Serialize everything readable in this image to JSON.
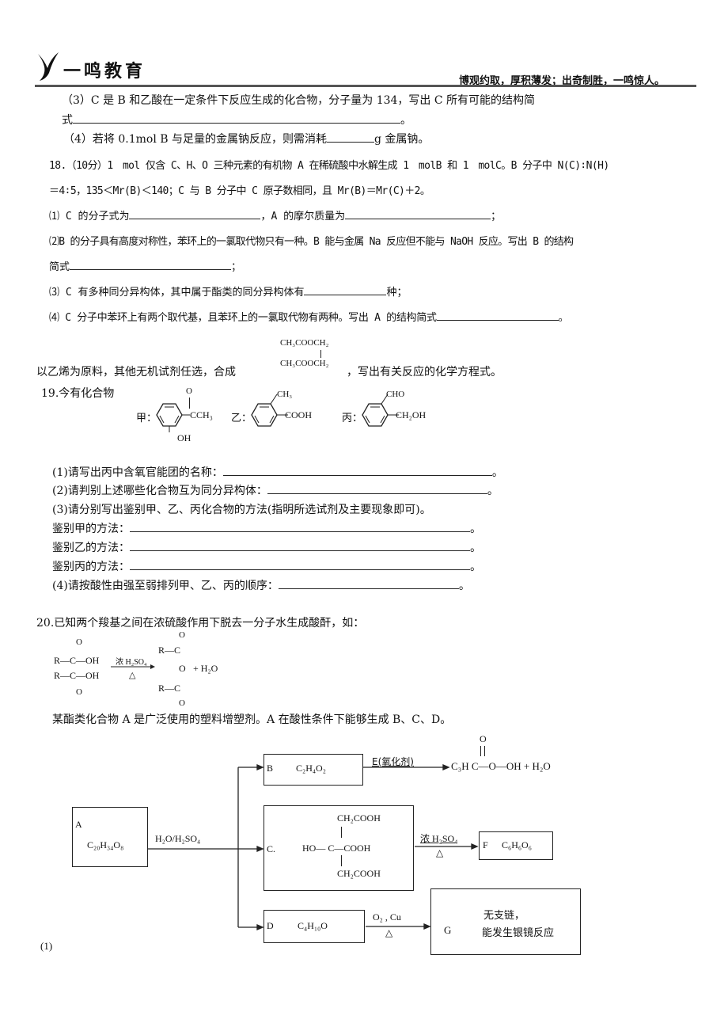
{
  "header": {
    "logo_text": "一鸣教育",
    "slogan": "博观约取，厚积薄发；出奇制胜，一鸣惊人。"
  },
  "q17_tail": {
    "part3_line1": "（3）C 是 B 和乙酸在一定条件下反应生成的化合物，分子量为 134，写出 C 所有可能的结构简",
    "part3_line2_prefix": "式",
    "part3_line2_suffix": "。",
    "part4_prefix": "（4）若将 0.1mol B 与足量的金属钠反应，则需消耗",
    "part4_suffix": "g 金属钠。"
  },
  "q18": {
    "line1": "18.（10分）1　mol 仅含 C、H、O 三种元素的有机物 A 在稀硫酸中水解生成 1　molB 和 1　molC。B 分子中 N(C)∶N(H)",
    "line2": "＝4∶5，135＜Mr(B)＜140；C 与 B 分子中 C 原子数相同，且 Mr(B)＝Mr(C)＋2。",
    "p1_a": "⑴ C 的分子式为",
    "p1_b": "，A 的摩尔质量为",
    "p1_c": "；",
    "p2_line1": "⑵B 的分子具有高度对称性，苯环上的一氯取代物只有一种。B 能与金属 Na 反应但不能与 NaOH 反应。写出 B 的结构",
    "p2_line2_prefix": "简式",
    "p2_line2_suffix": "；",
    "p3_prefix": "⑶ C 有多种同分异构体，其中属于酯类的同分异构体有",
    "p3_suffix": "种；",
    "p4_prefix": "⑷ C 分子中苯环上有两个取代基，且苯环上的一氯取代物有两种。写出 A 的结构简式",
    "p4_suffix": "。"
  },
  "synthesis": {
    "prefix": "以乙烯为原料，其他无机试剂任选，合成",
    "formula_top": "CH₃COOCH₂",
    "formula_bottom": "CH₃COOCH₂",
    "suffix": "，写出有关反应的化学方程式。"
  },
  "q19": {
    "title": "19.今有化合物",
    "compounds": [
      {
        "label": "甲：",
        "sub_top": "O",
        "sub_side": "CCH₃",
        "sub_bottom": "OH"
      },
      {
        "label": "乙：",
        "sub_top": "CH₃",
        "sub_side": "COOH"
      },
      {
        "label": "丙：",
        "sub_top": "CHO",
        "sub_side": "CH₂OH"
      }
    ],
    "questions": [
      {
        "prefix": "(1)请写出丙中含氧官能团的名称：",
        "suffix": "。"
      },
      {
        "prefix": "(2)请判别上述哪些化合物互为同分异构体：",
        "suffix": "。"
      },
      {
        "prefix": "(3)请分别写出鉴别甲、乙、丙化合物的方法(指明所选试剂及主要现象即可)。",
        "suffix": ""
      },
      {
        "prefix": "鉴别甲的方法：",
        "suffix": "。"
      },
      {
        "prefix": "鉴别乙的方法：",
        "suffix": "。"
      },
      {
        "prefix": "鉴别丙的方法：",
        "suffix": "。"
      },
      {
        "prefix": "(4)请按酸性由强至弱排列甲、乙、丙的顺序：",
        "suffix": "。"
      }
    ]
  },
  "q20": {
    "intro": "20.已知两个羧基之间在浓硫酸作用下脱去一分子水生成酸酐，如：",
    "reaction": {
      "reactant_top": "R—C—OH",
      "reactant_bottom": "R—C—OH",
      "o": "O",
      "condition_top": "浓 H₂SO₄",
      "condition_bottom": "△",
      "product_r": "R—C",
      "product_bridge_o": "O",
      "byproduct": "+ H₂O"
    },
    "statement": "某酯类化合物 A 是广泛使用的塑料增塑剂。A 在酸性条件下能够生成 B、C、D。",
    "flow": {
      "A": {
        "label": "A",
        "formula": "C₂₀H₃₄O₈"
      },
      "hydrolysis": "H₂O/H₂SO₄",
      "B": {
        "label": "B",
        "formula": "C₂H₄O₂"
      },
      "B_reagent": "E(氧化剂)",
      "B_product": "C₃H C—O—OH + H₂O",
      "B_product_o": "O",
      "C": {
        "label": "C.",
        "top": "CH₂COOH",
        "middle": "HO— C—COOH",
        "bottom": "CH₂COOH"
      },
      "C_reagent_top": "浓 H₂SO₄",
      "C_reagent_bottom": "△",
      "F": {
        "label": "F",
        "formula": "C₆H₆O₆"
      },
      "D": {
        "label": "D",
        "formula": "C₄H₁₀O"
      },
      "D_reagent_top": "O₂ , Cu",
      "D_reagent_bottom": "△",
      "G": {
        "label": "G",
        "line1": "无支链，",
        "line2": "能发生银镜反应"
      }
    },
    "part1_label": "(1)"
  }
}
